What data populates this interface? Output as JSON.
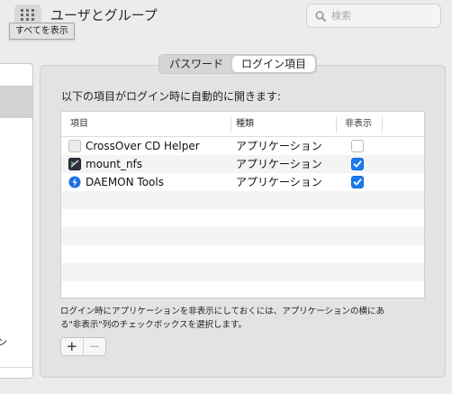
{
  "toolbar": {
    "title": "ユーザとグループ",
    "search_placeholder": "検索",
    "tooltip": "すべてを表示"
  },
  "users_panel": {
    "bottom_text": "ン"
  },
  "tabs": [
    {
      "label": "パスワード",
      "active": false
    },
    {
      "label": "ログイン項目",
      "active": true
    }
  ],
  "description": "以下の項目がログイン時に自動的に開きます:",
  "table": {
    "columns": [
      "項目",
      "種類",
      "非表示"
    ],
    "rows": [
      {
        "name": "CrossOver CD Helper",
        "kind": "アプリケーション",
        "hidden": false,
        "icon": "crossover-icon"
      },
      {
        "name": "mount_nfs",
        "kind": "アプリケーション",
        "hidden": true,
        "icon": "terminal-exec-icon"
      },
      {
        "name": "DAEMON Tools",
        "kind": "アプリケーション",
        "hidden": true,
        "icon": "daemon-tools-icon"
      }
    ]
  },
  "note": {
    "line1": "ログイン時にアプリケーションを非表示にしておくには、アプリケーションの横にあ",
    "line2": "る\"非表示\"列のチェックボックスを選択します。"
  },
  "buttons": {
    "add": "+",
    "remove": "−"
  },
  "colors": {
    "accent": "#1a7cf0",
    "window_bg": "#ececec",
    "panel_bg": "#e3e3e3"
  }
}
